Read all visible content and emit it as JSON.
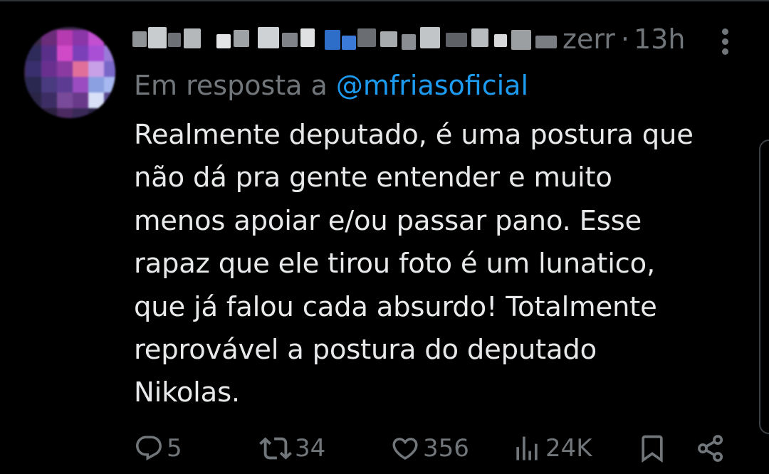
{
  "tweet": {
    "author_handle_tail": "zerr",
    "separator": "·",
    "time": "13h",
    "reply_prefix": "Em resposta a",
    "reply_mention": "@mfriasoficial",
    "text": "Realmente deputado, é uma postura que\nnão dá pra gente entender e muito\nmenos apoiar e/ou passar pano. Esse\nrapaz que ele tirou foto é um lunatico,\nque já falou cada absurdo! Totalmente\nreprovável a postura do deputado\nNikolas."
  },
  "actions": {
    "replies": "5",
    "reposts": "34",
    "likes": "356",
    "views": "24K"
  },
  "icons": {
    "reply": "reply-icon",
    "repost": "repost-icon",
    "like": "heart-icon",
    "views": "views-icon",
    "bookmark": "bookmark-icon",
    "share": "share-icon",
    "more": "more-icon"
  },
  "colors": {
    "background": "#000000",
    "text": "#e7e9ea",
    "muted": "#71767b",
    "accent": "#1d9bf0"
  }
}
